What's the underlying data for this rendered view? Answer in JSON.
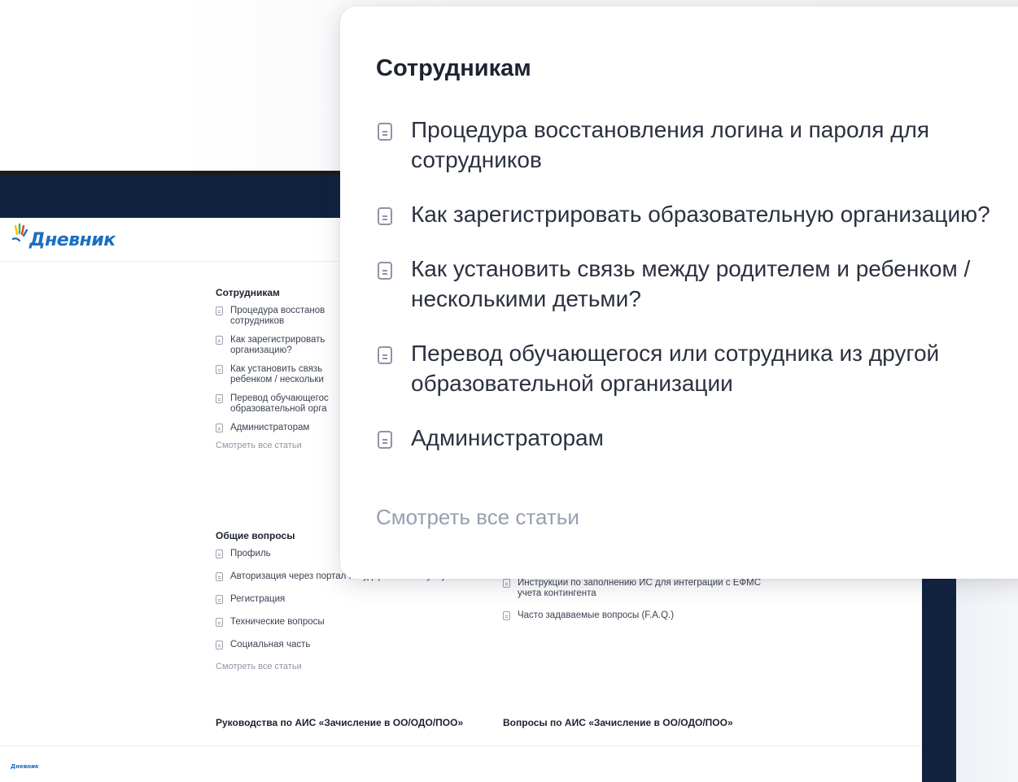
{
  "brand": {
    "name": "Дневник",
    "colors": {
      "nav": "#11223f",
      "logo": "#1a6fbf",
      "accent_yellow": "#f5c400",
      "accent_green": "#3fb34f"
    }
  },
  "zoom_card": {
    "title": "Сотрудникам",
    "items": [
      "Процедура восстановления логина и пароля для сотрудников",
      "Как зарегистрировать образовательную организацию?",
      "Как установить связь между родителем и ребенком / несколькими детьми?",
      "Перевод обучающегося или сотрудника из другой образовательной организации",
      "Администраторам"
    ],
    "see_all": "Смотреть все статьи"
  },
  "page": {
    "sections": {
      "staff": {
        "title": "Сотрудникам",
        "items": [
          "Процедура восстанов",
          "сотрудников",
          "Как зарегистрировать",
          "организацию?",
          "Как установить связь",
          "ребенком / нескольки",
          "Перевод обучающегос",
          "образовательной орга",
          "Администраторам"
        ],
        "see_all": "Смотреть все статьи"
      },
      "general": {
        "title": "Общие вопросы",
        "items": [
          "Профиль",
          "Авторизация через портал Государственных услуг",
          "Регистрация",
          "Технические вопросы",
          "Социальная часть"
        ],
        "see_all": "Смотреть все статьи"
      },
      "right_partial": {
        "items": [
          "Инструкции по заполнению ИС для интеграции с ЕФМС учета контингента",
          "Часто задаваемые вопросы (F.A.Q.)"
        ]
      },
      "guides": {
        "title": "Руководства по АИС «Зачисление в ОО/ОДО/ПОО»"
      },
      "questions": {
        "title": "Вопросы по АИС «Зачисление в ОО/ОДО/ПОО»"
      }
    },
    "footer_logo": "Дневник"
  }
}
